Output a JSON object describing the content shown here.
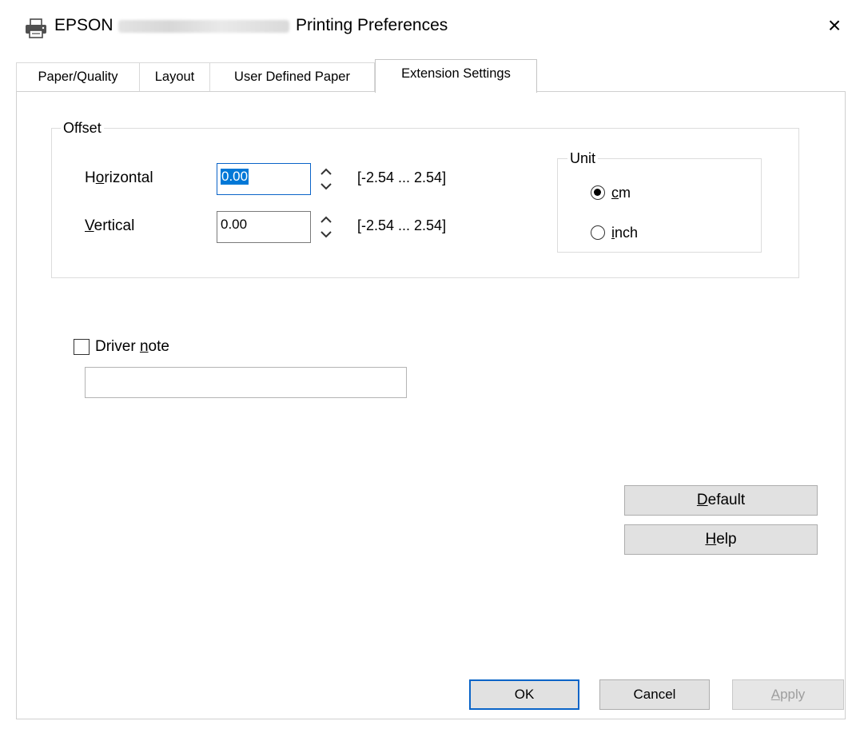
{
  "window": {
    "brand": "EPSON",
    "title": "Printing Preferences",
    "close": "×"
  },
  "tabs": [
    {
      "label": "Paper/Quality"
    },
    {
      "label": "Layout"
    },
    {
      "label": "User Defined Paper"
    },
    {
      "label": "Extension Settings"
    }
  ],
  "offset": {
    "group_label": "Offset",
    "horizontal": {
      "label_pre": "H",
      "label_mn": "o",
      "label_post": "rizontal",
      "value": "0.00",
      "range": "[-2.54 ... 2.54]"
    },
    "vertical": {
      "label_mn": "V",
      "label_post": "ertical",
      "value": "0.00",
      "range": "[-2.54 ... 2.54]"
    }
  },
  "unit": {
    "group_label": "Unit",
    "cm": {
      "mn": "c",
      "rest": "m",
      "selected": true
    },
    "inch": {
      "mn": "i",
      "rest": "nch",
      "selected": false
    }
  },
  "driver_note": {
    "pre": "Driver ",
    "mn": "n",
    "post": "ote",
    "checked": false,
    "value": ""
  },
  "buttons": {
    "default": {
      "mn": "D",
      "rest": "efault"
    },
    "help": {
      "mn": "H",
      "rest": "elp"
    },
    "ok": "OK",
    "cancel": "Cancel",
    "apply": {
      "mn": "A",
      "rest": "pply"
    }
  },
  "icons": {
    "printer": "printer-icon",
    "close": "close-icon",
    "spinner": "spinner-icon"
  },
  "colors": {
    "focus": "#0078d7",
    "default_button_border": "#0a64c8"
  }
}
